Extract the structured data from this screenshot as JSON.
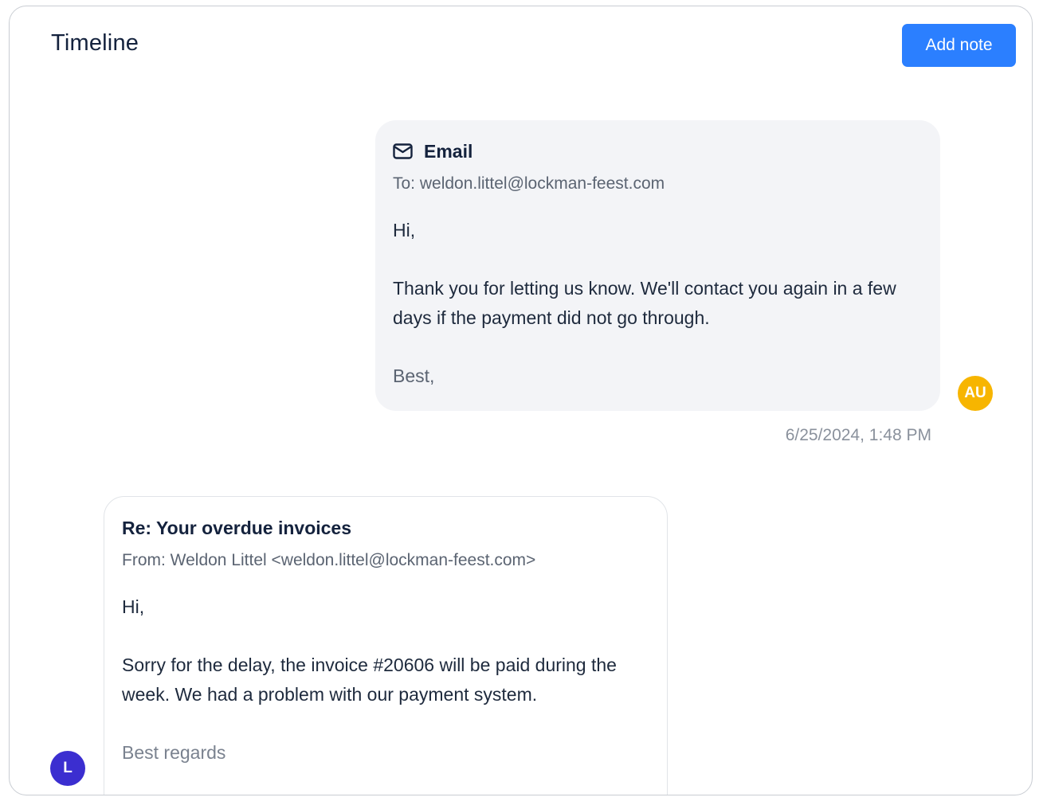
{
  "header": {
    "title": "Timeline",
    "add_note_label": "Add note"
  },
  "colors": {
    "accent": "#2b7fff",
    "avatar_au": "#f7b500",
    "avatar_l": "#3b2ed0"
  },
  "messages": [
    {
      "direction": "outgoing",
      "icon": "mail-icon",
      "title": "Email",
      "meta": "To: weldon.littel@lockman-feest.com",
      "greeting": "Hi,",
      "paragraph": "Thank you for letting us know. We'll contact you again in a few days if the payment did not go through.",
      "signoff": "Best,",
      "avatar": "AU",
      "timestamp": "6/25/2024, 1:48 PM"
    },
    {
      "direction": "incoming",
      "title": "Re: Your overdue invoices",
      "meta": "From: Weldon Littel <weldon.littel@lockman-feest.com>",
      "greeting": "Hi,",
      "paragraph": "Sorry for the delay, the invoice #20606 will be paid during the week. We had a problem with our payment system.",
      "signoff": "Best regards",
      "avatar": "L"
    }
  ]
}
